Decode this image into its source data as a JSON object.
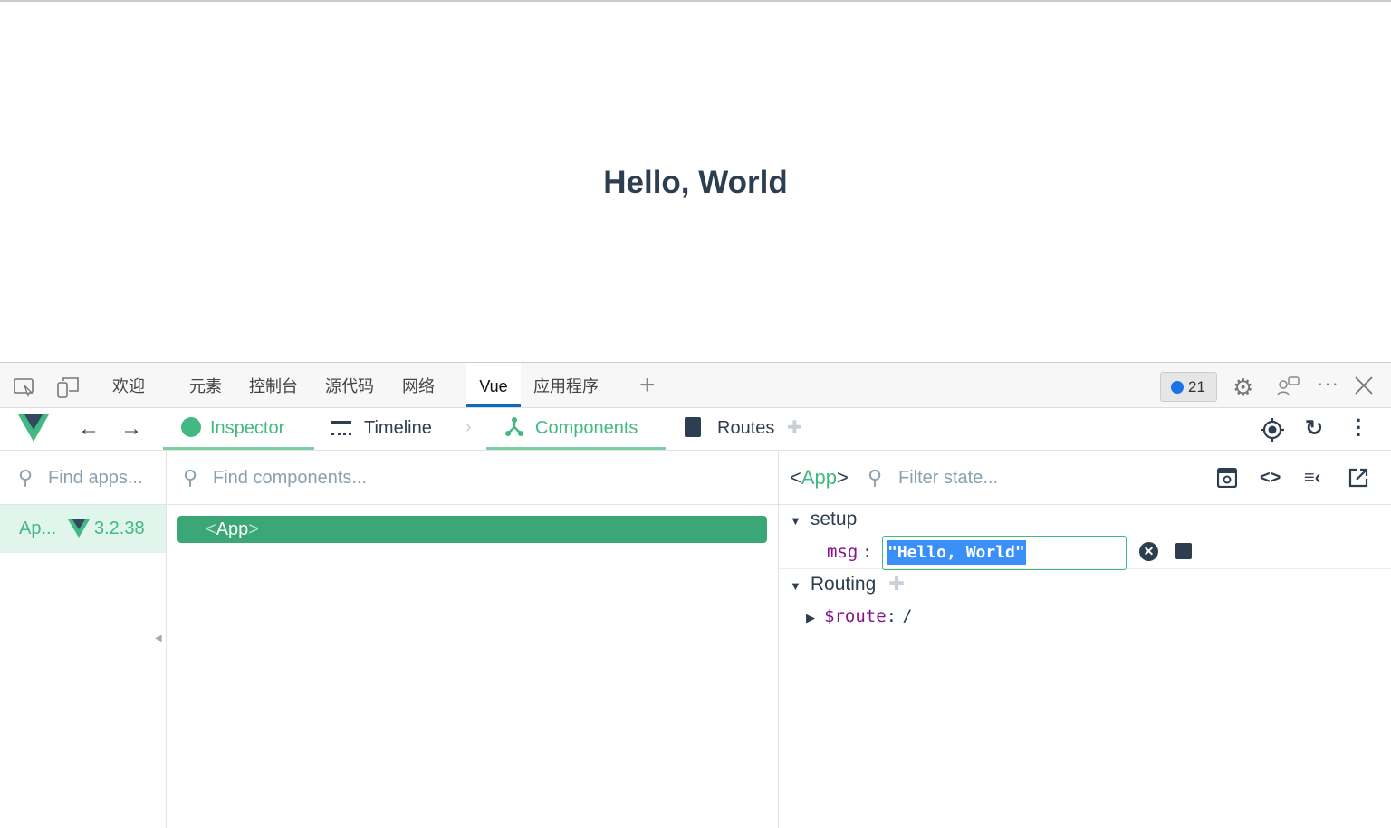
{
  "page": {
    "heading": "Hello, World"
  },
  "devtools": {
    "tabs": [
      "欢迎",
      "元素",
      "控制台",
      "源代码",
      "网络",
      "Vue",
      "应用程序"
    ],
    "active_tab": "Vue",
    "issues_count": "21"
  },
  "vue": {
    "tabs": {
      "inspector": "Inspector",
      "timeline": "Timeline",
      "components": "Components",
      "routes": "Routes"
    }
  },
  "apps": {
    "search_placeholder": "Find apps...",
    "items": [
      {
        "name": "Ap...",
        "version": "3.2.38"
      }
    ]
  },
  "components": {
    "search_placeholder": "Find components...",
    "tree": [
      {
        "open": "<",
        "name": "App",
        "close": ">"
      }
    ]
  },
  "state": {
    "component_open": "<",
    "component": "App",
    "component_close": ">",
    "filter_placeholder": "Filter state...",
    "sections": [
      {
        "name": "setup",
        "fields": [
          {
            "key": "msg",
            "sep": ":",
            "value": "\"Hello, World\""
          }
        ]
      },
      {
        "name": "Routing",
        "fields": [
          {
            "key": "$route",
            "sep": ":",
            "value": "/"
          }
        ]
      }
    ]
  },
  "colors": {
    "vue_green": "#42b883",
    "selected": "#3ba776",
    "edge_blue": "#0f6cbd"
  }
}
